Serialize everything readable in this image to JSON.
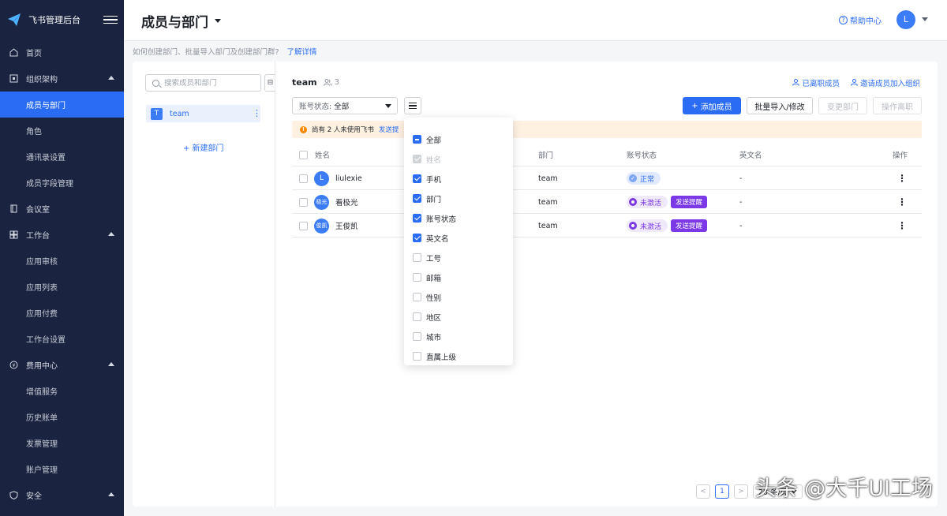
{
  "sidebar": {
    "brand": "飞书管理后台",
    "items": [
      {
        "label": "首页",
        "icon": "home-icon"
      },
      {
        "label": "组织架构",
        "icon": "org-icon"
      },
      {
        "label": "成员与部门"
      },
      {
        "label": "角色"
      },
      {
        "label": "通讯录设置"
      },
      {
        "label": "成员字段管理"
      },
      {
        "label": "会议室",
        "icon": "meeting-room-icon"
      },
      {
        "label": "工作台",
        "icon": "grid-icon"
      },
      {
        "label": "应用审核"
      },
      {
        "label": "应用列表"
      },
      {
        "label": "应用付费"
      },
      {
        "label": "工作台设置"
      },
      {
        "label": "费用中心",
        "icon": "coin-icon"
      },
      {
        "label": "增值服务"
      },
      {
        "label": "历史账单"
      },
      {
        "label": "发票管理"
      },
      {
        "label": "账户管理"
      },
      {
        "label": "安全",
        "icon": "shield-icon"
      }
    ]
  },
  "header": {
    "title": "成员与部门",
    "help": "帮助中心",
    "avatar": "L"
  },
  "hint": {
    "text": "如何创建部门、批量导入部门及创建部门群?",
    "link": "了解详情"
  },
  "tree": {
    "search_placeholder": "搜索成员和部门",
    "collapse": "⊟",
    "node_badge": "T",
    "node_label": "team",
    "new_dept": "+ 新建部门"
  },
  "team": {
    "name": "team",
    "count": "3",
    "link_left": "已离职成员",
    "link_invite": "邀请成员加入组织"
  },
  "toolbar": {
    "status_prefix": "账号状态:",
    "status_value": "全部",
    "add_member": "添加成员",
    "import": "批量导入/修改",
    "change_dept": "变更部门",
    "leave": "操作离职"
  },
  "banner": {
    "text": "尚有 2 人未使用飞书",
    "link": "发送提"
  },
  "table": {
    "headers": {
      "name": "姓名",
      "dept": "部门",
      "status": "账号状态",
      "en_name": "英文名",
      "ops": "操作"
    },
    "rows": [
      {
        "avatar": "L",
        "name": "liulexie",
        "dept": "team",
        "status": "正常",
        "remind": "",
        "en_name": "-"
      },
      {
        "avatar": "极光",
        "name": "看极光",
        "dept": "team",
        "status": "未激活",
        "remind": "发送提醒",
        "en_name": "-"
      },
      {
        "avatar": "俊凯",
        "name": "王俊凯",
        "dept": "team",
        "status": "未激活",
        "remind": "发送提醒",
        "en_name": "-"
      }
    ]
  },
  "column_menu": {
    "options": [
      {
        "label": "全部",
        "state": "indeterminate"
      },
      {
        "label": "姓名",
        "state": "disabled"
      },
      {
        "label": "手机",
        "state": "checked"
      },
      {
        "label": "部门",
        "state": "checked"
      },
      {
        "label": "账号状态",
        "state": "checked"
      },
      {
        "label": "英文名",
        "state": "checked"
      },
      {
        "label": "工号",
        "state": "unchecked"
      },
      {
        "label": "邮箱",
        "state": "unchecked"
      },
      {
        "label": "性别",
        "state": "unchecked"
      },
      {
        "label": "地区",
        "state": "unchecked"
      },
      {
        "label": "城市",
        "state": "unchecked"
      },
      {
        "label": "直属上级",
        "state": "unchecked"
      }
    ]
  },
  "pagination": {
    "prev": "<",
    "current": "1",
    "next": ">",
    "page_size": "20 条/页"
  },
  "watermark": "头条 @大千UI工场",
  "colors": {
    "primary": "#2a6cf3",
    "sidebar": "#1a2340",
    "inactive": "#7a38e6"
  }
}
